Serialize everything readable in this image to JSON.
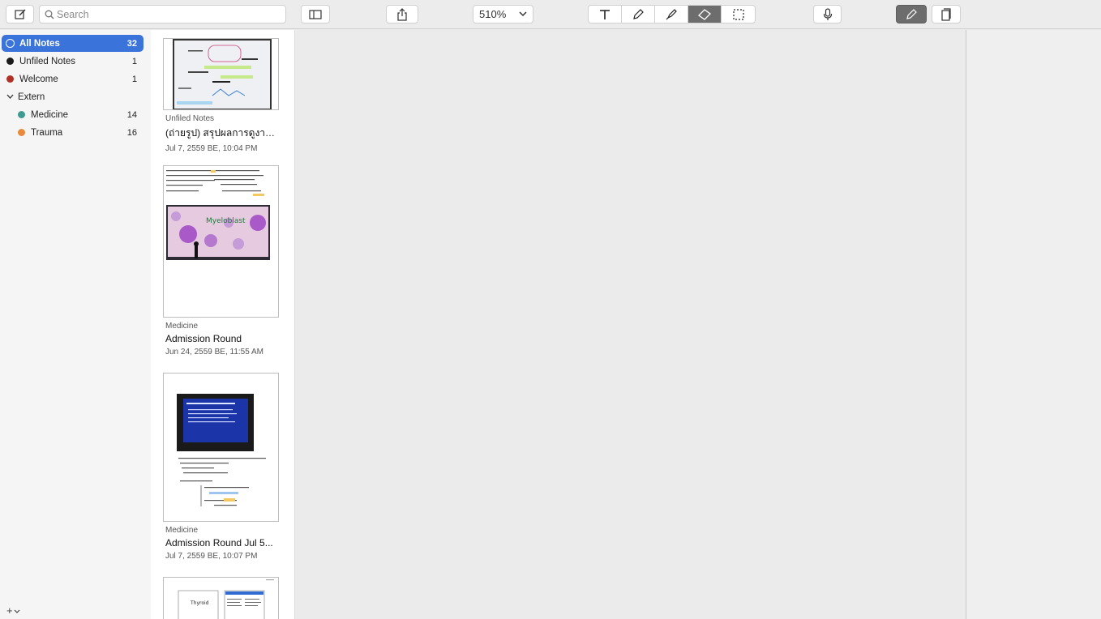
{
  "toolbar": {
    "search_placeholder": "Search",
    "zoom_level": "510%"
  },
  "sidebar": {
    "items": [
      {
        "label": "All Notes",
        "count": "32",
        "color": "#3a73d9"
      },
      {
        "label": "Unfiled Notes",
        "count": "1",
        "color": "#1a1a1a"
      },
      {
        "label": "Welcome",
        "count": "1",
        "color": "#b03025"
      },
      {
        "label": "Extern",
        "count": ""
      },
      {
        "label": "Medicine",
        "count": "14",
        "color": "#3f9a8f"
      },
      {
        "label": "Trauma",
        "count": "16",
        "color": "#e88a3a"
      }
    ],
    "add_label": "+"
  },
  "notes": [
    {
      "folder": "Unfiled Notes",
      "title": "(ถ่ายรูป) สรุปผลการดูงาน...",
      "date": "Jul 7, 2559 BE, 10:04 PM"
    },
    {
      "folder": "Medicine",
      "title": "Admission Round",
      "date": "Jun 24, 2559 BE, 11:55 AM"
    },
    {
      "folder": "Medicine",
      "title": "Admission Round Jul 5...",
      "date": "Jul 7, 2559 BE, 10:07 PM"
    },
    {
      "folder": "",
      "title": "",
      "date": ""
    }
  ],
  "thumb_text": {
    "myeloblast": "Myeloblast",
    "thyroid": "Thyroid"
  }
}
